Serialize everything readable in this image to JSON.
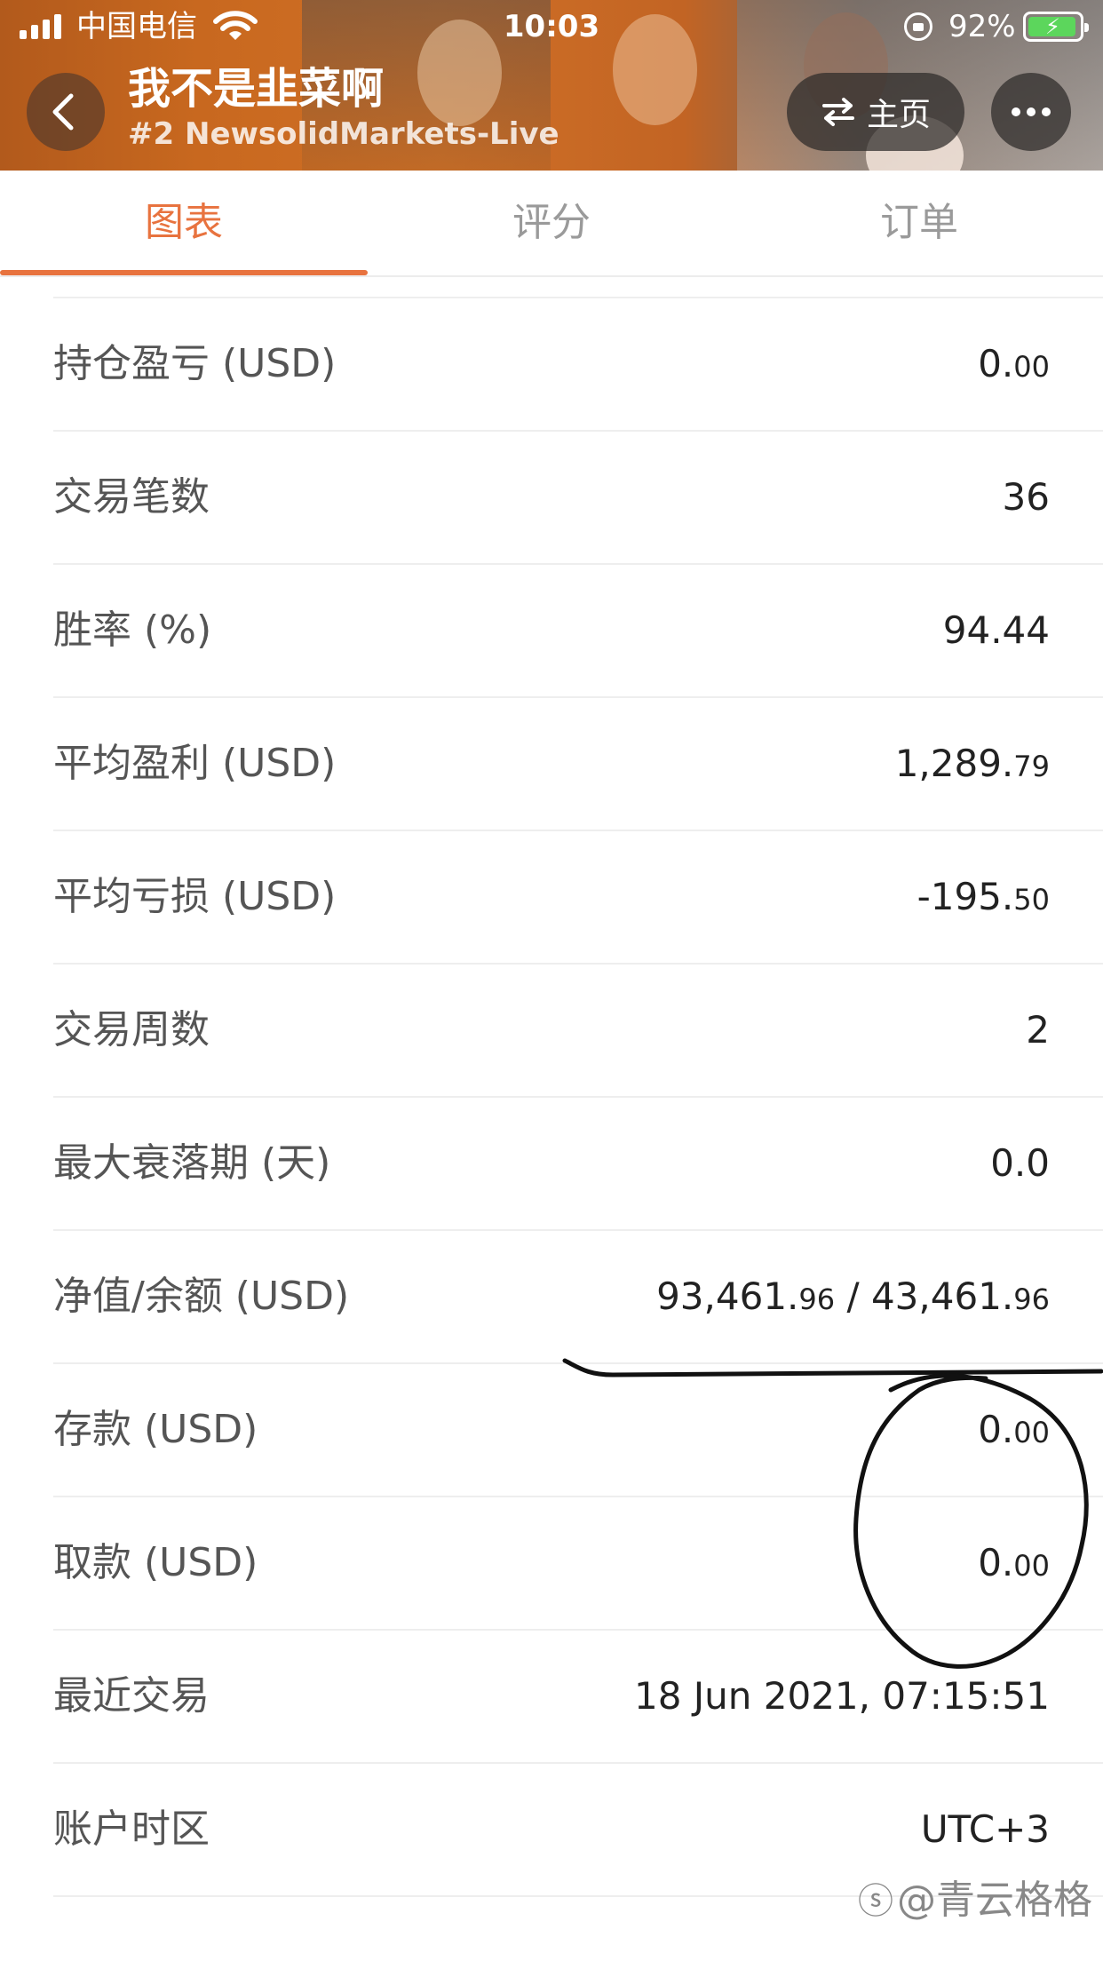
{
  "status_bar": {
    "carrier": "中国电信",
    "time": "10:03",
    "battery_percent": "92%",
    "icons": [
      "signal-icon",
      "wifi-icon",
      "rotation-lock-icon",
      "battery-charging-icon"
    ]
  },
  "header": {
    "title": "我不是韭菜啊",
    "subtitle": "#2 NewsolidMarkets-Live",
    "back_icon": "chevron-left-icon",
    "home_button_label": "主页",
    "home_button_icon": "swap-arrows-icon",
    "more_icon": "more-dots-icon"
  },
  "tabs": [
    {
      "label": "图表",
      "active": true
    },
    {
      "label": "评分",
      "active": false
    },
    {
      "label": "订单",
      "active": false
    }
  ],
  "stats": [
    {
      "label": "持仓盈亏 (USD)",
      "value_main": "0.",
      "value_dec": "00"
    },
    {
      "label": "交易笔数",
      "value_main": "36",
      "value_dec": ""
    },
    {
      "label": "胜率 (%)",
      "value_main": "94.44",
      "value_dec": ""
    },
    {
      "label": "平均盈利 (USD)",
      "value_main": "1,289.",
      "value_dec": "79"
    },
    {
      "label": "平均亏损 (USD)",
      "value_main": "-195.",
      "value_dec": "50"
    },
    {
      "label": "交易周数",
      "value_main": "2",
      "value_dec": ""
    },
    {
      "label": "最大衰落期 (天)",
      "value_main": "0.0",
      "value_dec": ""
    },
    {
      "label": "净值/余额 (USD)",
      "value_main": "93,461.",
      "value_dec": "96",
      "value_main2": " / 43,461.",
      "value_dec2": "96"
    },
    {
      "label": "存款 (USD)",
      "value_main": "0.",
      "value_dec": "00"
    },
    {
      "label": "取款 (USD)",
      "value_main": "0.",
      "value_dec": "00"
    },
    {
      "label": "最近交易",
      "value_main": "18 Jun 2021, 07:15:51",
      "value_dec": ""
    },
    {
      "label": "账户时区",
      "value_main": "UTC+3",
      "value_dec": ""
    }
  ],
  "watermark": {
    "text": "@青云格格",
    "icon": "weibo-icon"
  },
  "colors": {
    "accent": "#e8733f",
    "header_orange": "#c8681f",
    "divider": "#eeeeee"
  }
}
